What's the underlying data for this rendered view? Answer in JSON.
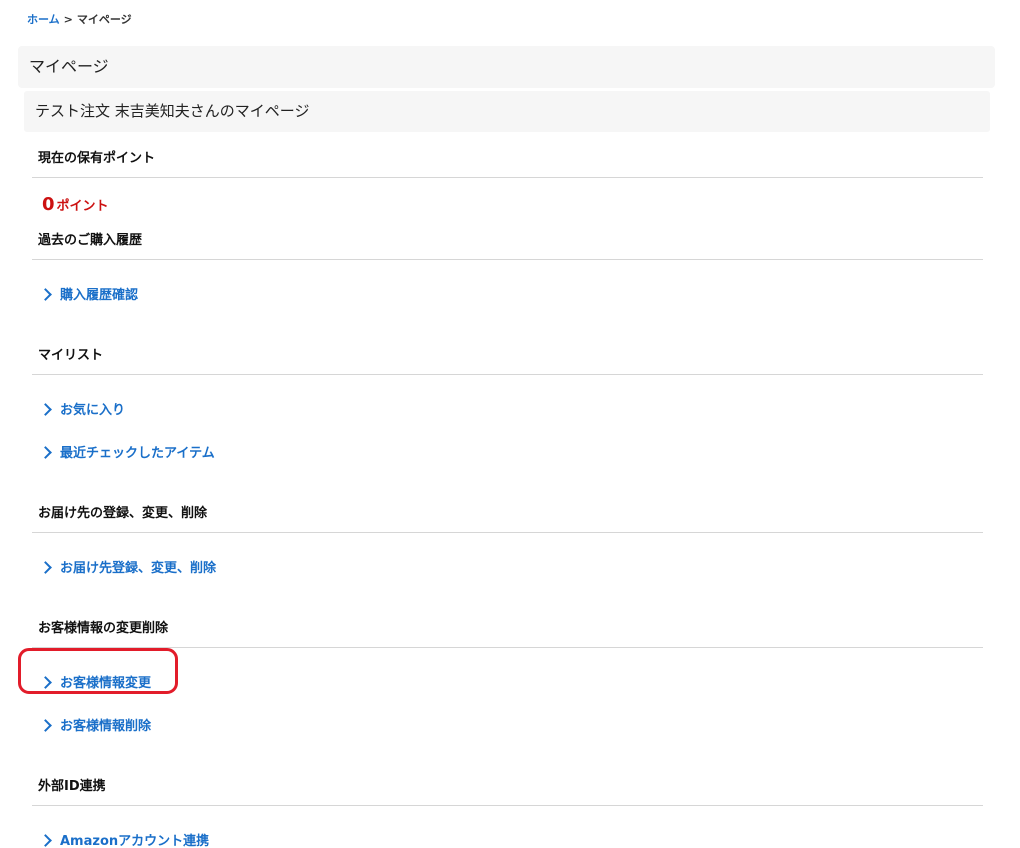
{
  "breadcrumb": {
    "home": "ホーム",
    "separator": ">",
    "current": "マイページ"
  },
  "page_title": "マイページ",
  "greeting": "テスト注文 末吉美知夫さんのマイページ",
  "points_section": {
    "title": "現在の保有ポイント",
    "value": "0",
    "unit": "ポイント"
  },
  "history_section": {
    "title": "過去のご購入履歴",
    "links": [
      "購入履歴確認"
    ]
  },
  "mylist_section": {
    "title": "マイリスト",
    "links": [
      "お気に入り",
      "最近チェックしたアイテム"
    ]
  },
  "address_section": {
    "title": "お届け先の登録、変更、削除",
    "links": [
      "お届け先登録、変更、削除"
    ]
  },
  "customer_section": {
    "title": "お客様情報の変更削除",
    "links": [
      "お客様情報変更",
      "お客様情報削除"
    ]
  },
  "external_section": {
    "title": "外部ID連携",
    "links": [
      "Amazonアカウント連携"
    ]
  },
  "colors": {
    "link": "#1a6fc9",
    "points": "#cc1111",
    "highlight": "#e21c2a"
  }
}
